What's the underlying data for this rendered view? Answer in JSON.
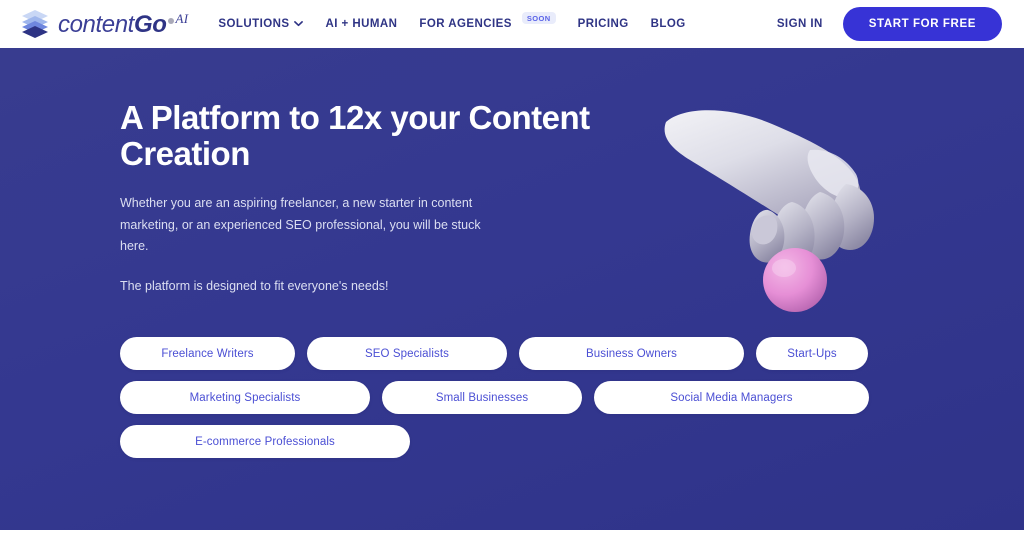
{
  "header": {
    "logo": {
      "icon": "layers-stack-icon",
      "word_light": "content",
      "word_bold": "Go",
      "dot": "",
      "superscript": "AI"
    },
    "nav": [
      {
        "label": "SOLUTIONS",
        "icon": "chevron-down-icon",
        "has_chevron": true,
        "badge": ""
      },
      {
        "label": "AI + HUMAN",
        "icon": "",
        "has_chevron": false,
        "badge": ""
      },
      {
        "label": "FOR AGENCIES",
        "icon": "",
        "has_chevron": false,
        "badge": "SOON"
      },
      {
        "label": "PRICING",
        "icon": "",
        "has_chevron": false,
        "badge": ""
      },
      {
        "label": "BLOG",
        "icon": "",
        "has_chevron": false,
        "badge": ""
      }
    ],
    "sign_in": "SIGN IN",
    "cta": "START FOR FREE"
  },
  "hero": {
    "title": "A Platform to 12x your Content Creation",
    "paragraph_1": "Whether you are an aspiring freelancer, a new starter in content marketing, or an experienced SEO professional, you will be stuck here.",
    "paragraph_2": "The platform is designed to fit everyone's needs!",
    "illustration": "hand-holding-pink-sphere-3d-render",
    "audience_pills": [
      [
        {
          "label": "Freelance Writers",
          "width": "w175"
        },
        {
          "label": "SEO Specialists",
          "width": "w200"
        },
        {
          "label": "Business Owners",
          "width": "w225"
        },
        {
          "label": "Start-Ups",
          "width": "w112"
        }
      ],
      [
        {
          "label": "Marketing Specialists",
          "width": "w250"
        },
        {
          "label": "Small Businesses",
          "width": "w200"
        },
        {
          "label": "Social Media Managers",
          "width": "w275"
        }
      ],
      [
        {
          "label": "E-commerce Professionals",
          "width": "w290"
        }
      ]
    ]
  },
  "colors": {
    "hero_background": "#34388f",
    "cta_blue": "#3733d6",
    "nav_text": "#2f3485",
    "pill_text": "#4b4fd4",
    "pill_background": "#ffffff",
    "badge_background": "#e9ecfb",
    "badge_text": "#5a63e8",
    "hero_paragraph": "#dcdff2",
    "sphere_pink": "#e48fd4",
    "hand_grey": "#dcdce4"
  }
}
